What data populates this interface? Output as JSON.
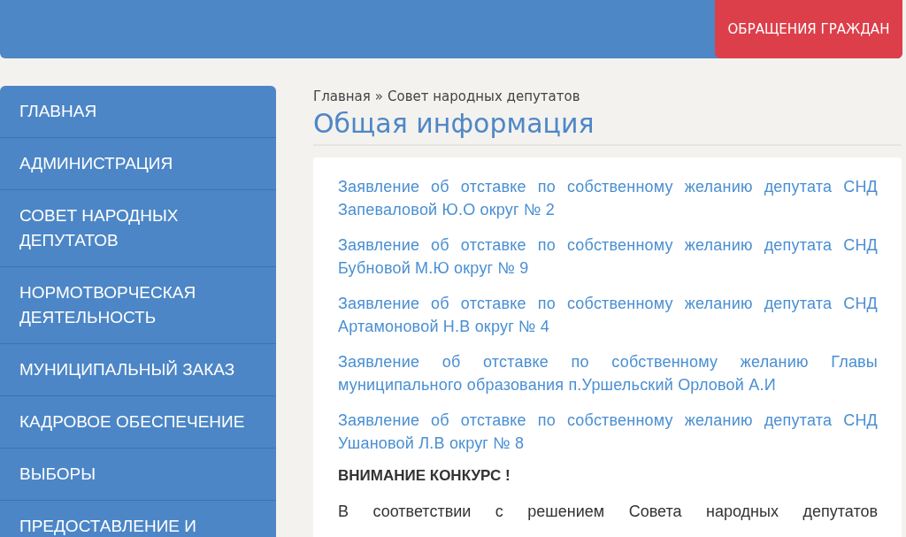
{
  "header": {
    "button": "ОБРАЩЕНИЯ ГРАЖДАН"
  },
  "sidebar": {
    "items": [
      {
        "label": "ГЛАВНАЯ"
      },
      {
        "label": "АДМИНИСТРАЦИЯ"
      },
      {
        "label": "СОВЕТ НАРОДНЫХ ДЕПУТАТОВ"
      },
      {
        "label": "НОРМОТВОРЧЕСКАЯ ДЕЯТЕЛЬНОСТЬ"
      },
      {
        "label": "МУНИЦИПАЛЬНЫЙ ЗАКАЗ"
      },
      {
        "label": "КАДРОВОЕ ОБЕСПЕЧЕНИЕ"
      },
      {
        "label": "ВЫБОРЫ"
      },
      {
        "label": "ПРЕДОСТАВЛЕНИЕ И"
      }
    ]
  },
  "breadcrumb": {
    "items": [
      "Главная",
      "Совет народных депутатов"
    ],
    "separator": "»"
  },
  "title": "Общая информация",
  "content": {
    "links": [
      "Заявление об отставке по собственному желанию депутата СНД Запеваловой Ю.О округ № 2",
      "Заявление об отставке по собственному желанию депутата СНД Бубновой М.Ю округ № 9",
      "Заявление об отставке по собственному желанию депутата СНД Артамоновой Н.В округ № 4",
      "Заявление об отставке по собственному желанию Главы муниципального образования п.Уршельский Орловой А.И",
      "Заявление об отставке по собственному желанию депутата СНД Ушановой Л.В округ № 8"
    ],
    "heading": "ВНИМАНИЕ КОНКУРС !",
    "paragraph": "В соответствии с решением Совета народных депутатов"
  }
}
